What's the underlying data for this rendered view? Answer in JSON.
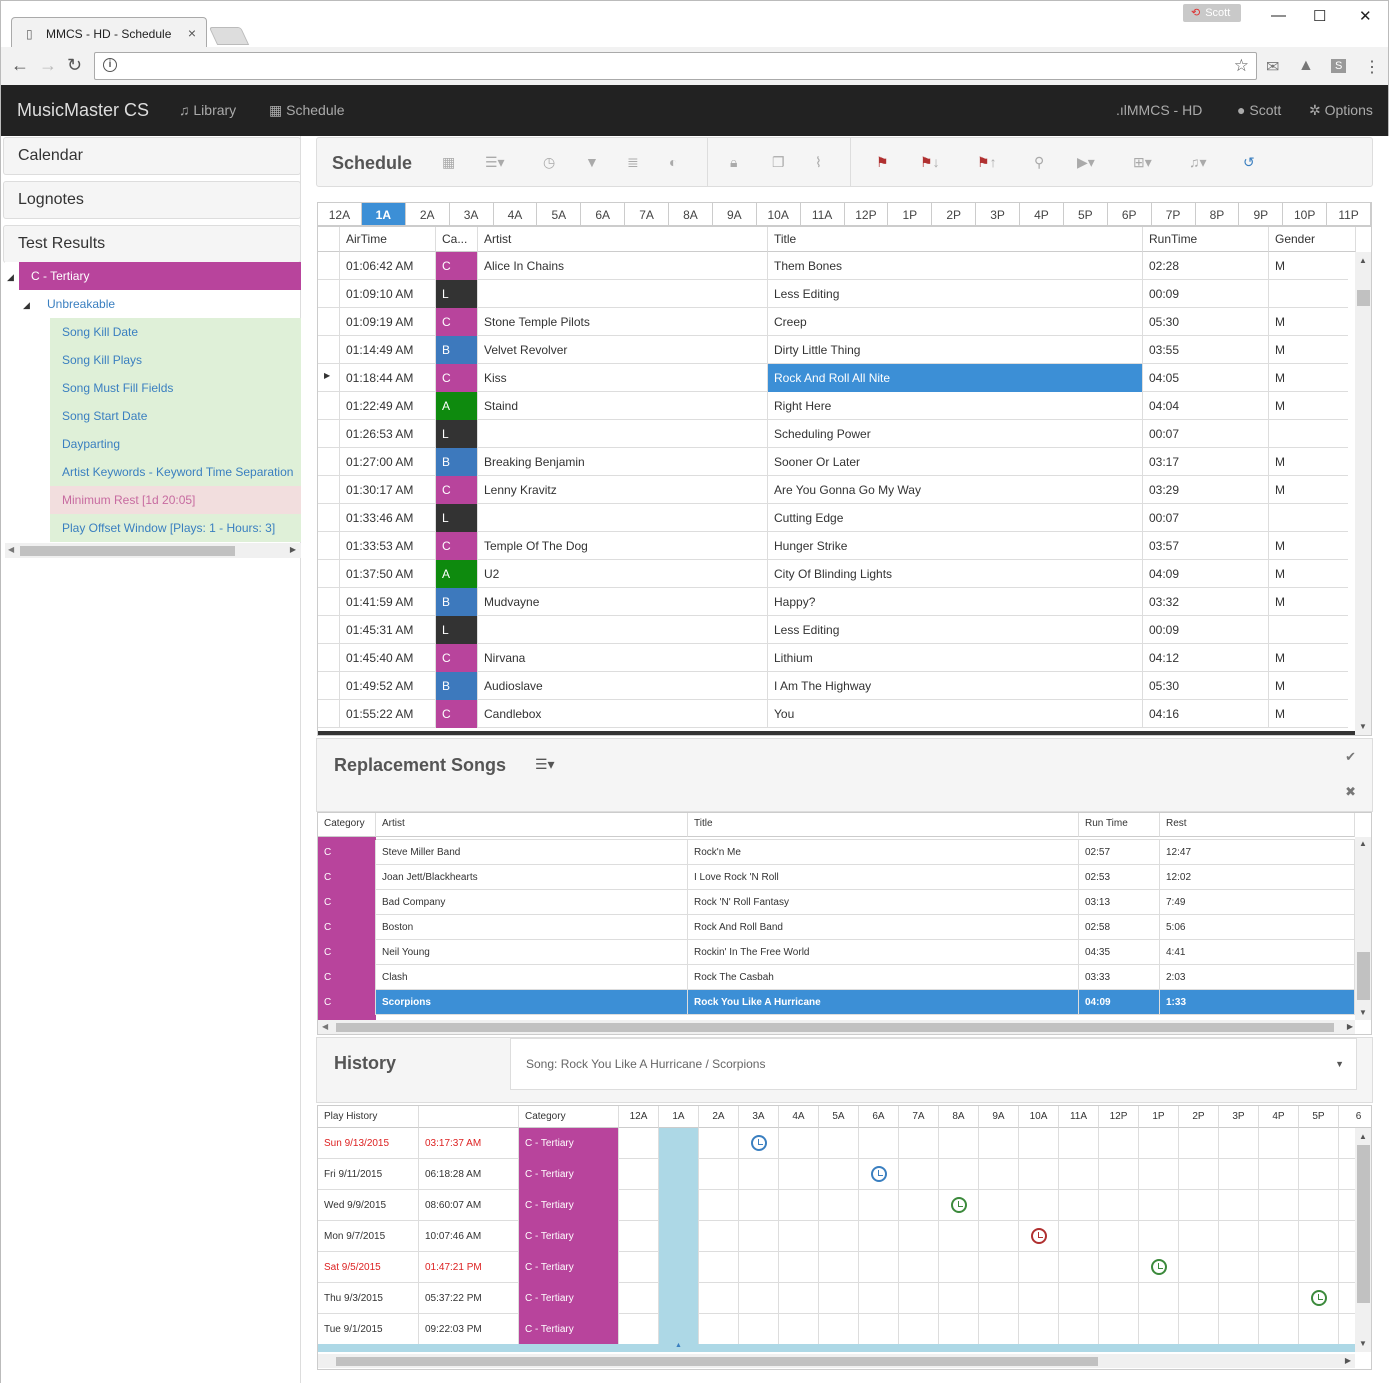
{
  "browser": {
    "tab_title": "MMCS - HD - Schedule",
    "user_badge": "Scott",
    "controls": {
      "minimize": "—",
      "maximize": "☐",
      "close": "✕"
    }
  },
  "navbar": {
    "brand": "MusicMaster CS",
    "library": "Library",
    "schedule": "Schedule",
    "station": "MMCS - HD",
    "user": "Scott",
    "options": "Options"
  },
  "sidebar": {
    "panels": [
      "Calendar",
      "Lognotes",
      "Test Results"
    ],
    "tree": {
      "root": "C - Tertiary",
      "child": "Unbreakable",
      "items": [
        {
          "label": "Song Kill Date",
          "status": "pass"
        },
        {
          "label": "Song Kill Plays",
          "status": "pass"
        },
        {
          "label": "Song Must Fill Fields",
          "status": "pass"
        },
        {
          "label": "Song Start Date",
          "status": "pass"
        },
        {
          "label": "Dayparting",
          "status": "pass"
        },
        {
          "label": "Artist Keywords - Keyword Time Separation",
          "status": "pass"
        },
        {
          "label": "Minimum Rest [1d 20:05]",
          "status": "fail"
        },
        {
          "label": "Play Offset Window [Plays: 1 - Hours: 3]",
          "status": "pass"
        }
      ]
    }
  },
  "schedule": {
    "title": "Schedule",
    "hours": [
      "12A",
      "1A",
      "2A",
      "3A",
      "4A",
      "5A",
      "6A",
      "7A",
      "8A",
      "9A",
      "10A",
      "11A",
      "12P",
      "1P",
      "2P",
      "3P",
      "4P",
      "5P",
      "6P",
      "7P",
      "8P",
      "9P",
      "10P",
      "11P"
    ],
    "selected_hour": "1A",
    "columns": [
      "AirTime",
      "Ca...",
      "Artist",
      "Title",
      "RunTime",
      "Gender"
    ],
    "rows": [
      {
        "airtime": "01:06:42 AM",
        "cat": "C",
        "artist": "Alice In Chains",
        "title": "Them Bones",
        "runtime": "02:28",
        "gender": "M"
      },
      {
        "airtime": "01:09:10 AM",
        "cat": "L",
        "artist": "",
        "title": "Less Editing",
        "runtime": "00:09",
        "gender": ""
      },
      {
        "airtime": "01:09:19 AM",
        "cat": "C",
        "artist": "Stone Temple Pilots",
        "title": "Creep",
        "runtime": "05:30",
        "gender": "M"
      },
      {
        "airtime": "01:14:49 AM",
        "cat": "B",
        "artist": "Velvet Revolver",
        "title": "Dirty Little Thing",
        "runtime": "03:55",
        "gender": "M"
      },
      {
        "airtime": "01:18:44 AM",
        "cat": "C",
        "artist": "Kiss",
        "title": "Rock And Roll All Nite",
        "runtime": "04:05",
        "gender": "M",
        "selected": true
      },
      {
        "airtime": "01:22:49 AM",
        "cat": "A",
        "artist": "Staind",
        "title": "Right Here",
        "runtime": "04:04",
        "gender": "M"
      },
      {
        "airtime": "01:26:53 AM",
        "cat": "L",
        "artist": "",
        "title": "Scheduling Power",
        "runtime": "00:07",
        "gender": ""
      },
      {
        "airtime": "01:27:00 AM",
        "cat": "B",
        "artist": "Breaking Benjamin",
        "title": "Sooner Or Later",
        "runtime": "03:17",
        "gender": "M"
      },
      {
        "airtime": "01:30:17 AM",
        "cat": "C",
        "artist": "Lenny Kravitz",
        "title": "Are You Gonna Go My Way",
        "runtime": "03:29",
        "gender": "M"
      },
      {
        "airtime": "01:33:46 AM",
        "cat": "L",
        "artist": "",
        "title": "Cutting Edge",
        "runtime": "00:07",
        "gender": ""
      },
      {
        "airtime": "01:33:53 AM",
        "cat": "C",
        "artist": "Temple Of The Dog",
        "title": "Hunger Strike",
        "runtime": "03:57",
        "gender": "M"
      },
      {
        "airtime": "01:37:50 AM",
        "cat": "A",
        "artist": "U2",
        "title": "City Of Blinding Lights",
        "runtime": "04:09",
        "gender": "M"
      },
      {
        "airtime": "01:41:59 AM",
        "cat": "B",
        "artist": "Mudvayne",
        "title": "Happy?",
        "runtime": "03:32",
        "gender": "M"
      },
      {
        "airtime": "01:45:31 AM",
        "cat": "L",
        "artist": "",
        "title": "Less Editing",
        "runtime": "00:09",
        "gender": ""
      },
      {
        "airtime": "01:45:40 AM",
        "cat": "C",
        "artist": "Nirvana",
        "title": "Lithium",
        "runtime": "04:12",
        "gender": "M"
      },
      {
        "airtime": "01:49:52 AM",
        "cat": "B",
        "artist": "Audioslave",
        "title": "I Am The Highway",
        "runtime": "05:30",
        "gender": "M"
      },
      {
        "airtime": "01:55:22 AM",
        "cat": "C",
        "artist": "Candlebox",
        "title": "You",
        "runtime": "04:16",
        "gender": "M"
      }
    ]
  },
  "replacement": {
    "title": "Replacement Songs",
    "columns": [
      "Category",
      "Artist",
      "Title",
      "Run Time",
      "Rest"
    ],
    "rows": [
      {
        "cat": "C",
        "artist": "Steve Miller Band",
        "title": "Rock'n Me",
        "runtime": "02:57",
        "rest": "12:47"
      },
      {
        "cat": "C",
        "artist": "Joan Jett/Blackhearts",
        "title": "I Love Rock 'N Roll",
        "runtime": "02:53",
        "rest": "12:02"
      },
      {
        "cat": "C",
        "artist": "Bad Company",
        "title": "Rock 'N' Roll Fantasy",
        "runtime": "03:13",
        "rest": "7:49"
      },
      {
        "cat": "C",
        "artist": "Boston",
        "title": "Rock And Roll Band",
        "runtime": "02:58",
        "rest": "5:06"
      },
      {
        "cat": "C",
        "artist": "Neil Young",
        "title": "Rockin' In The Free World",
        "runtime": "04:35",
        "rest": "4:41"
      },
      {
        "cat": "C",
        "artist": "Clash",
        "title": "Rock The Casbah",
        "runtime": "03:33",
        "rest": "2:03"
      },
      {
        "cat": "C",
        "artist": "Scorpions",
        "title": "Rock You Like A Hurricane",
        "runtime": "04:09",
        "rest": "1:33",
        "selected": true
      }
    ]
  },
  "history": {
    "title": "History",
    "song_select": "Song: Rock You Like A Hurricane / Scorpions",
    "columns": {
      "play_history": "Play History",
      "category": "Category"
    },
    "hours": [
      "12A",
      "1A",
      "2A",
      "3A",
      "4A",
      "5A",
      "6A",
      "7A",
      "8A",
      "9A",
      "10A",
      "11A",
      "12P",
      "1P",
      "2P",
      "3P",
      "4P",
      "5P",
      "6"
    ],
    "rows": [
      {
        "date": "Sun 9/13/2015",
        "time": "03:17:37 AM",
        "cat": "C - Tertiary",
        "red": true,
        "hour": 3,
        "clock": "#3a7fc0"
      },
      {
        "date": "Fri 9/11/2015",
        "time": "06:18:28 AM",
        "cat": "C - Tertiary",
        "red": false,
        "hour": 6,
        "clock": "#3a7fc0"
      },
      {
        "date": "Wed 9/9/2015",
        "time": "08:60:07 AM",
        "cat": "C - Tertiary",
        "red": false,
        "hour": 8,
        "clock": "#3c8a3c"
      },
      {
        "date": "Mon 9/7/2015",
        "time": "10:07:46 AM",
        "cat": "C - Tertiary",
        "red": false,
        "hour": 10,
        "clock": "#b03030"
      },
      {
        "date": "Sat 9/5/2015",
        "time": "01:47:21 PM",
        "cat": "C - Tertiary",
        "red": true,
        "hour": 13,
        "clock": "#3c8a3c"
      },
      {
        "date": "Thu 9/3/2015",
        "time": "05:37:22 PM",
        "cat": "C - Tertiary",
        "red": false,
        "hour": 17,
        "clock": "#3c8a3c"
      },
      {
        "date": "Tue 9/1/2015",
        "time": "09:22:03 PM",
        "cat": "C - Tertiary",
        "red": false,
        "hour": -1,
        "clock": ""
      }
    ]
  },
  "colors": {
    "C": "#b8449c",
    "L": "#333333",
    "B": "#3d79bd",
    "A": "#0e8a0e",
    "selected": "#3c8fd6",
    "hour_highlight": "#add8e6",
    "pass": "#dff0d8",
    "fail": "#f2dede"
  }
}
